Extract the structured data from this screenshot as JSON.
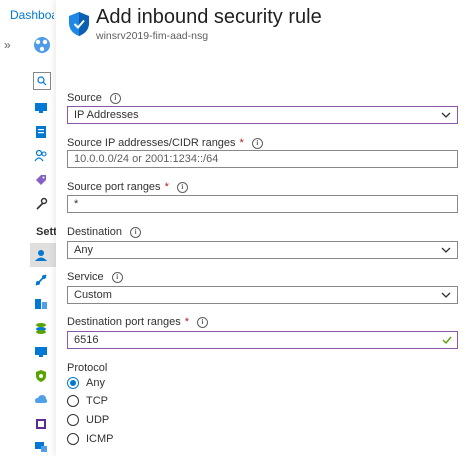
{
  "background_blade": {
    "breadcrumb": "Dashboard",
    "expand_glyph": "»",
    "section_label": "Settings"
  },
  "header": {
    "title": "Add inbound security rule",
    "subtitle": "winsrv2019-fim-aad-nsg",
    "icon": "shield-icon"
  },
  "form": {
    "source": {
      "label": "Source",
      "value": "IP Addresses"
    },
    "source_ip": {
      "label": "Source IP addresses/CIDR ranges",
      "required_mark": "*",
      "placeholder": "10.0.0.0/24 or 2001:1234::/64"
    },
    "source_ports": {
      "label": "Source port ranges",
      "required_mark": "*",
      "value": "*"
    },
    "destination": {
      "label": "Destination",
      "value": "Any"
    },
    "service": {
      "label": "Service",
      "value": "Custom"
    },
    "dest_ports": {
      "label": "Destination port ranges",
      "required_mark": "*",
      "value": "6516"
    },
    "protocol": {
      "label": "Protocol",
      "options": [
        "Any",
        "TCP",
        "UDP",
        "ICMP"
      ],
      "selected": "Any"
    }
  },
  "colors": {
    "accent": "#0078d4",
    "required": "#a4262c",
    "focus_border": "#8a58a8",
    "valid_check": "#57a300"
  }
}
